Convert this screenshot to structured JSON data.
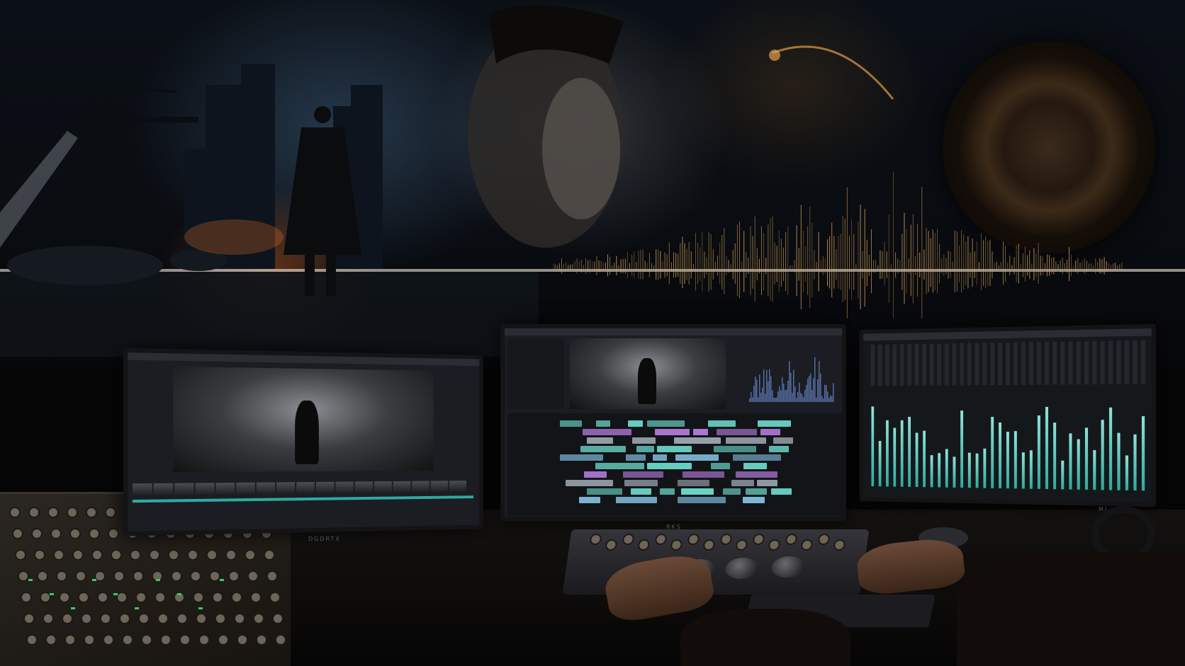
{
  "scene": {
    "description_tags": [
      "video-editing-studio",
      "cinematic-collage"
    ],
    "accent_colors": {
      "fire": "#ff7a2a",
      "waveform_gold": "#d9a45a",
      "mixer_teal": "#4fd1c5",
      "timeline_purple": "#b27ad9",
      "timeline_teal": "#6ad6c8"
    }
  },
  "monitors": {
    "left_badge": "DGDRTX",
    "center_badge": "RKS",
    "right_badge": "MJ"
  }
}
